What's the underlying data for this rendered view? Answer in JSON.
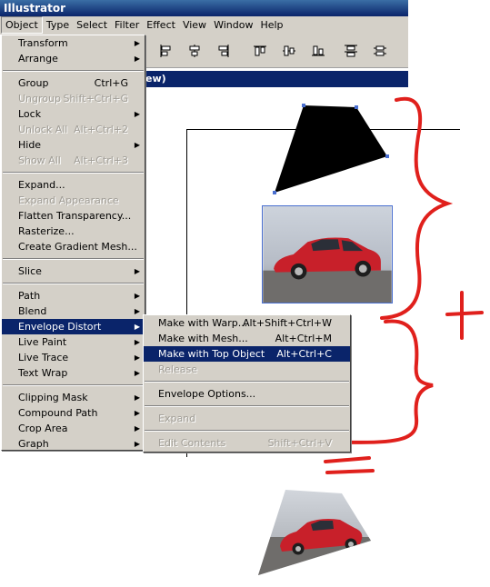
{
  "app": {
    "title": "Illustrator"
  },
  "menubar": [
    "Object",
    "Type",
    "Select",
    "Filter",
    "Effect",
    "View",
    "Window",
    "Help"
  ],
  "docbar": {
    "title": "ew)"
  },
  "object_menu": {
    "groups": [
      [
        {
          "label": "Transform",
          "shortcut": "",
          "submenu": true,
          "disabled": false
        },
        {
          "label": "Arrange",
          "shortcut": "",
          "submenu": true,
          "disabled": false
        }
      ],
      [
        {
          "label": "Group",
          "shortcut": "Ctrl+G",
          "submenu": false,
          "disabled": false
        },
        {
          "label": "Ungroup",
          "shortcut": "Shift+Ctrl+G",
          "submenu": false,
          "disabled": true
        },
        {
          "label": "Lock",
          "shortcut": "",
          "submenu": true,
          "disabled": false
        },
        {
          "label": "Unlock All",
          "shortcut": "Alt+Ctrl+2",
          "submenu": false,
          "disabled": true
        },
        {
          "label": "Hide",
          "shortcut": "",
          "submenu": true,
          "disabled": false
        },
        {
          "label": "Show All",
          "shortcut": "Alt+Ctrl+3",
          "submenu": false,
          "disabled": true
        }
      ],
      [
        {
          "label": "Expand...",
          "shortcut": "",
          "submenu": false,
          "disabled": false
        },
        {
          "label": "Expand Appearance",
          "shortcut": "",
          "submenu": false,
          "disabled": true
        },
        {
          "label": "Flatten Transparency...",
          "shortcut": "",
          "submenu": false,
          "disabled": false
        },
        {
          "label": "Rasterize...",
          "shortcut": "",
          "submenu": false,
          "disabled": false
        },
        {
          "label": "Create Gradient Mesh...",
          "shortcut": "",
          "submenu": false,
          "disabled": false
        }
      ],
      [
        {
          "label": "Slice",
          "shortcut": "",
          "submenu": true,
          "disabled": false
        }
      ],
      [
        {
          "label": "Path",
          "shortcut": "",
          "submenu": true,
          "disabled": false
        },
        {
          "label": "Blend",
          "shortcut": "",
          "submenu": true,
          "disabled": false
        },
        {
          "label": "Envelope Distort",
          "shortcut": "",
          "submenu": true,
          "disabled": false,
          "highlighted": true
        },
        {
          "label": "Live Paint",
          "shortcut": "",
          "submenu": true,
          "disabled": false
        },
        {
          "label": "Live Trace",
          "shortcut": "",
          "submenu": true,
          "disabled": false
        },
        {
          "label": "Text Wrap",
          "shortcut": "",
          "submenu": true,
          "disabled": false
        }
      ],
      [
        {
          "label": "Clipping Mask",
          "shortcut": "",
          "submenu": true,
          "disabled": false
        },
        {
          "label": "Compound Path",
          "shortcut": "",
          "submenu": true,
          "disabled": false
        },
        {
          "label": "Crop Area",
          "shortcut": "",
          "submenu": true,
          "disabled": false
        },
        {
          "label": "Graph",
          "shortcut": "",
          "submenu": true,
          "disabled": false
        }
      ]
    ]
  },
  "envelope_submenu": {
    "groups": [
      [
        {
          "label": "Make with Warp...",
          "shortcut": "Alt+Shift+Ctrl+W",
          "disabled": false
        },
        {
          "label": "Make with Mesh...",
          "shortcut": "Alt+Ctrl+M",
          "disabled": false
        },
        {
          "label": "Make with Top Object",
          "shortcut": "Alt+Ctrl+C",
          "disabled": false,
          "highlighted": true
        },
        {
          "label": "Release",
          "shortcut": "",
          "disabled": true
        }
      ],
      [
        {
          "label": "Envelope Options...",
          "shortcut": "",
          "disabled": false
        }
      ],
      [
        {
          "label": "Expand",
          "shortcut": "",
          "disabled": true
        }
      ],
      [
        {
          "label": "Edit Contents",
          "shortcut": "Shift+Ctrl+V",
          "disabled": true
        }
      ]
    ]
  },
  "annotations": {
    "plus": "+",
    "equals": "=",
    "color": "#e0201c"
  },
  "colors": {
    "menu_bg": "#d4d0c8",
    "highlight": "#0a246a",
    "disabled": "#a09d96"
  }
}
